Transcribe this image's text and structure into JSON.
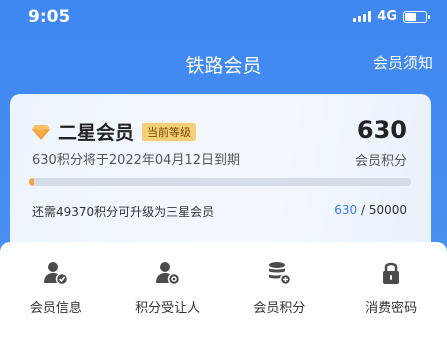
{
  "status_bar": {
    "time": "9:05",
    "network": "4G"
  },
  "nav": {
    "title": "铁路会员",
    "right_link": "会员须知"
  },
  "member_card": {
    "level_name": "二星会员",
    "level_tag": "当前等级",
    "expire_text": "630积分将于2022年04月12日到期",
    "points": "630",
    "points_label": "会员积分",
    "progress": {
      "current": 630,
      "target": 50000
    },
    "upgrade_text": "还需49370积分可升级为三星会员",
    "progress_current_text": "630",
    "progress_separator": " / ",
    "progress_target_text": "50000"
  },
  "menu": {
    "items": [
      {
        "label": "会员信息",
        "icon": "user-check-icon"
      },
      {
        "label": "积分受让人",
        "icon": "user-settings-icon"
      },
      {
        "label": "会员积分",
        "icon": "coins-icon"
      },
      {
        "label": "消费密码",
        "icon": "lock-icon"
      }
    ]
  },
  "colors": {
    "header_blue": "#4a90f0",
    "tag_gold": "#f6cf79",
    "progress_orange": "#f2a341",
    "progress_track": "#d5dce6",
    "accent_blue": "#3a7ee6",
    "icon_gray": "#4b4b4b"
  }
}
